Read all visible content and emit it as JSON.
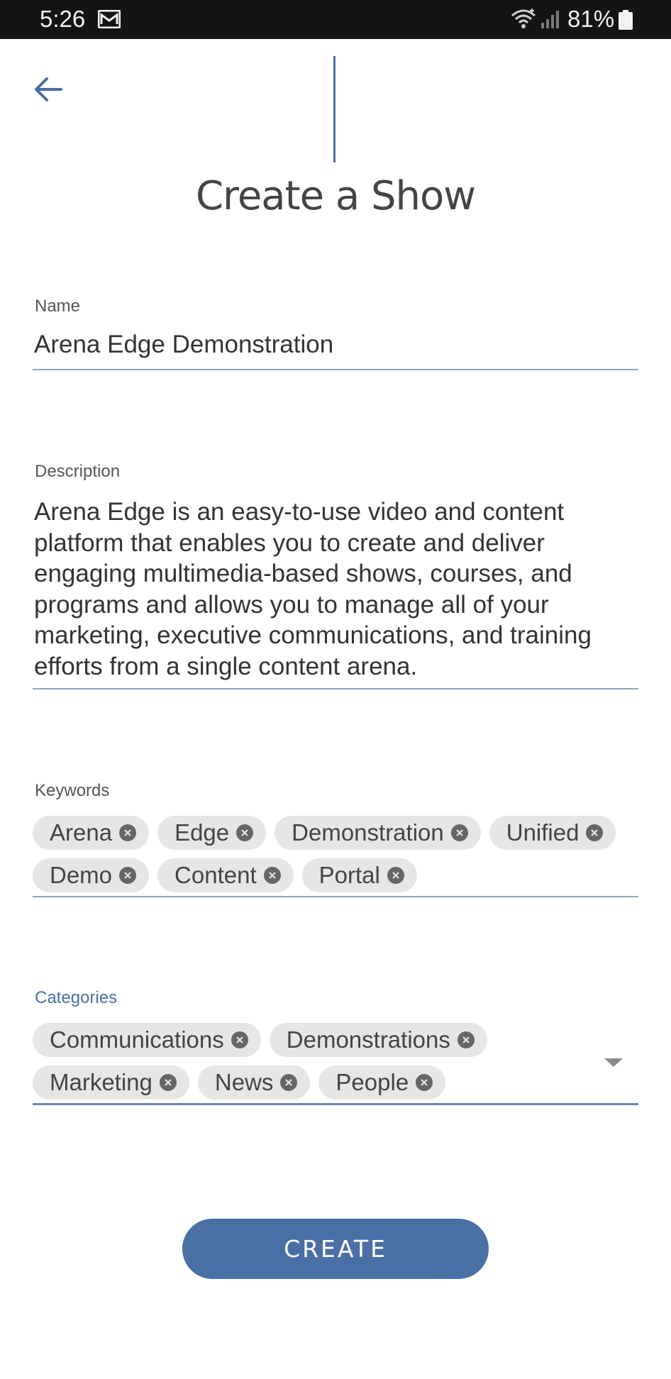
{
  "status_bar": {
    "time": "5:26",
    "battery": "81%"
  },
  "header": {
    "title": "Create a Show",
    "back_icon": "arrow-left-icon"
  },
  "form": {
    "name": {
      "label": "Name",
      "value": "Arena Edge Demonstration"
    },
    "description": {
      "label": "Description",
      "value": "Arena Edge is an easy-to-use video and content platform that enables you to create and deliver engaging multimedia-based shows, courses, and programs and allows you to manage all of your marketing, executive communications, and training efforts from a single content arena."
    },
    "keywords": {
      "label": "Keywords",
      "chips": [
        "Arena",
        "Edge",
        "Demonstration",
        "Unified",
        "Demo",
        "Content",
        "Portal"
      ]
    },
    "categories": {
      "label": "Categories",
      "chips": [
        "Communications",
        "Demonstrations",
        "Marketing",
        "News",
        "People"
      ]
    },
    "create_label": "CREATE"
  },
  "colors": {
    "accent": "#4a6fa5",
    "chip_bg": "#e6e6e6",
    "status_bar_bg": "#141414"
  }
}
